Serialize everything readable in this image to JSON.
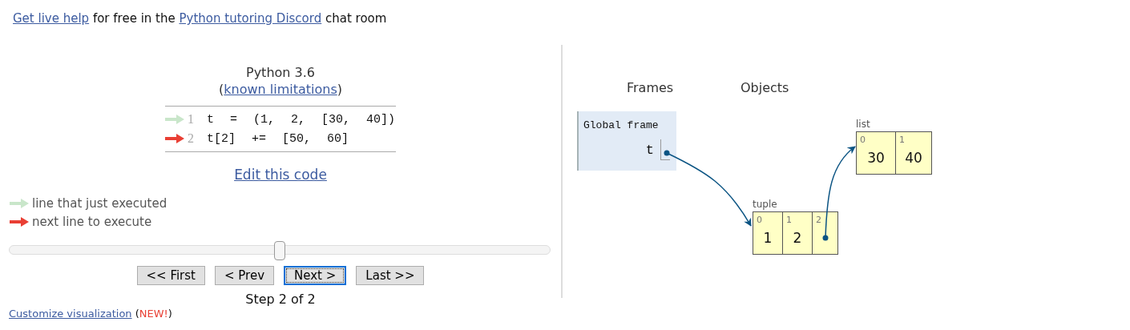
{
  "help_message": [
    {
      "kind": "link",
      "text": "Get live help"
    },
    {
      "kind": "text",
      "text": " for free in the "
    },
    {
      "kind": "link",
      "text": "Python tutoring Discord"
    },
    {
      "kind": "text",
      "text": " chat room"
    }
  ],
  "code_panel": {
    "language": "Python 3.6",
    "limitations": [
      {
        "kind": "text",
        "text": "("
      },
      {
        "kind": "link",
        "text": "known limitations"
      },
      {
        "kind": "text",
        "text": ")"
      }
    ],
    "lines": [
      {
        "number": "1",
        "code": "t = (1, 2, [30, 40])",
        "kind": "executed"
      },
      {
        "number": "2",
        "code": "t[2] += [50, 60]",
        "kind": "next"
      }
    ],
    "edit_link": "Edit this code",
    "legend": [
      {
        "kind": "executed",
        "label": "line that just executed"
      },
      {
        "kind": "next",
        "label": "next line to execute"
      }
    ],
    "slider": {
      "level": 0.5
    },
    "buttons": [
      {
        "label": "<< First",
        "focused": false
      },
      {
        "label": "< Prev",
        "focused": false
      },
      {
        "label": "Next >",
        "focused": true
      },
      {
        "label": "Last >>",
        "focused": false
      }
    ],
    "step": "Step 2 of 2",
    "customize": [
      {
        "kind": "link",
        "text": "Customize visualization"
      },
      {
        "kind": "text",
        "text": " ("
      },
      {
        "kind": "new",
        "text": "NEW!"
      },
      {
        "kind": "text",
        "text": ")"
      }
    ]
  },
  "visualization": {
    "frames_heading": "Frames",
    "objects_heading": "Objects",
    "frames": [
      {
        "name": "Global frame",
        "variables": [
          {
            "name": "t",
            "kind": "pointer"
          }
        ]
      }
    ],
    "objects": [
      {
        "kind": "tuple",
        "label": "tuple",
        "items": [
          {
            "index": "0",
            "kind": "value",
            "value": "1"
          },
          {
            "index": "1",
            "kind": "value",
            "value": "2"
          },
          {
            "index": "2",
            "kind": "pointer"
          }
        ]
      },
      {
        "kind": "list",
        "label": "list",
        "items": [
          {
            "index": "0",
            "kind": "value",
            "value": "30"
          },
          {
            "index": "1",
            "kind": "value",
            "value": "40"
          }
        ]
      }
    ]
  }
}
